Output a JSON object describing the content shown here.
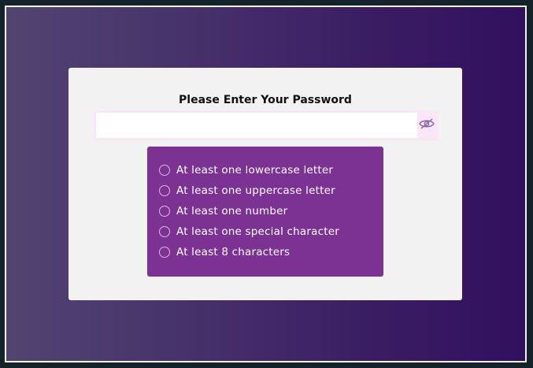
{
  "form": {
    "title": "Please Enter Your Password",
    "password_value": "",
    "visibility_icon": "eye-slash-icon"
  },
  "requirements": {
    "items": [
      {
        "label": "At least one lowercase letter",
        "met": false
      },
      {
        "label": "At least one uppercase letter",
        "met": false
      },
      {
        "label": "At least one number",
        "met": false
      },
      {
        "label": "At least one special character",
        "met": false
      },
      {
        "label": "At least 8 characters",
        "met": false
      }
    ]
  },
  "colors": {
    "background_gradient": [
      "#524471",
      "#31105e"
    ],
    "card": "#f2f2f3",
    "requirements_panel": "#7b3293",
    "input_border": "#f9e6f7"
  }
}
